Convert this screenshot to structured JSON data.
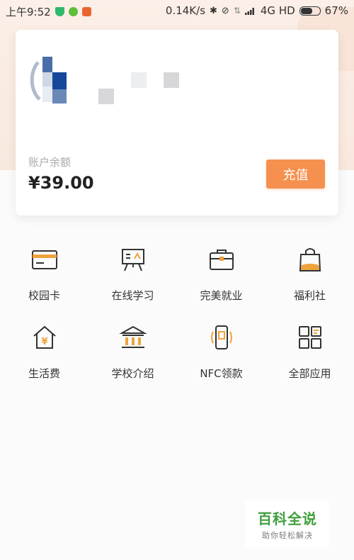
{
  "status_bar": {
    "time": "上午9:52",
    "network_speed": "0.14K/s",
    "network_type": "4G HD",
    "battery": "67%",
    "battery_level": 0.67
  },
  "account": {
    "balance_label": "账户余额",
    "balance_value": "¥39.00",
    "recharge_label": "充值"
  },
  "services": [
    {
      "label": "校园卡",
      "icon": "card-icon"
    },
    {
      "label": "在线学习",
      "icon": "board-icon"
    },
    {
      "label": "完美就业",
      "icon": "briefcase-icon"
    },
    {
      "label": "福利社",
      "icon": "shopping-bag-icon"
    },
    {
      "label": "生活费",
      "icon": "house-yuan-icon"
    },
    {
      "label": "学校介绍",
      "icon": "building-icon"
    },
    {
      "label": "NFC领款",
      "icon": "nfc-phone-icon"
    },
    {
      "label": "全部应用",
      "icon": "apps-grid-icon"
    }
  ],
  "watermark": {
    "title": "百科全说",
    "subtitle": "助你轻松解决"
  },
  "colors": {
    "accent": "#f5904f",
    "icon_stroke": "#333333",
    "watermark_green": "#3f9f3c"
  }
}
